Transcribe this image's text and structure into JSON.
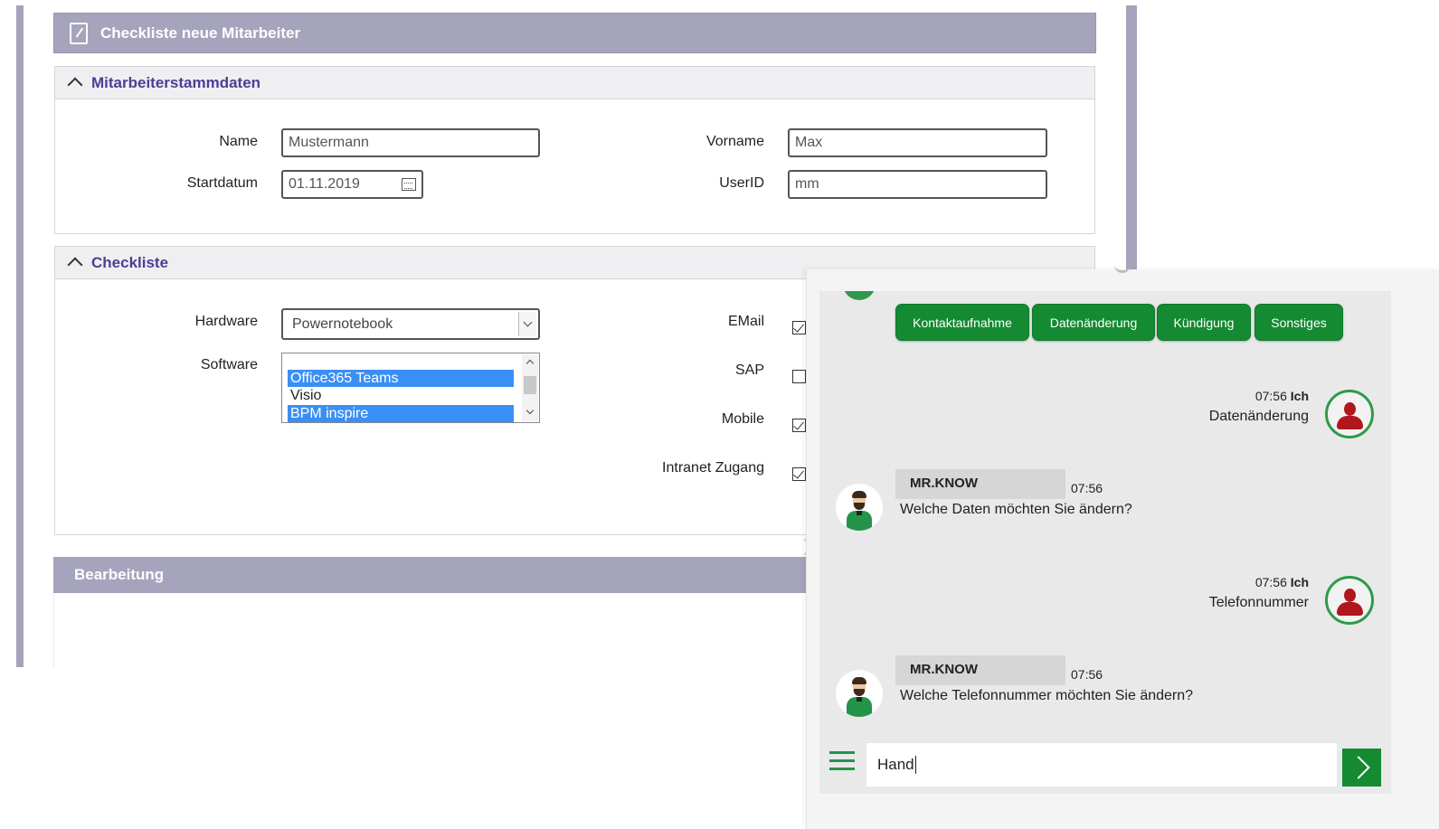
{
  "form": {
    "title": "Checkliste neue Mitarbeiter",
    "sections": {
      "stammdaten": {
        "title": "Mitarbeiterstammdaten",
        "name_label": "Name",
        "name_value": "Mustermann",
        "vorname_label": "Vorname",
        "vorname_value": "Max",
        "startdatum_label": "Startdatum",
        "startdatum_value": "01.11.2019",
        "userid_label": "UserID",
        "userid_value": "mm"
      },
      "checkliste": {
        "title": "Checkliste",
        "hardware_label": "Hardware",
        "hardware_value": "Powernotebook",
        "software_label": "Software",
        "software_options": [
          {
            "label": "Office365 Teams",
            "selected": true
          },
          {
            "label": "Visio",
            "selected": false
          },
          {
            "label": "BPM inspire",
            "selected": true
          }
        ],
        "checks": [
          {
            "label": "EMail",
            "checked": true
          },
          {
            "label": "SAP",
            "checked": false
          },
          {
            "label": "Mobile",
            "checked": true
          },
          {
            "label": "Intranet Zugang",
            "checked": true
          }
        ]
      }
    },
    "bearbeitung_title": "Bearbeitung"
  },
  "chat": {
    "quick_buttons": [
      "Kontaktaufnahme",
      "Datenänderung",
      "Kündigung",
      "Sonstiges"
    ],
    "messages": [
      {
        "from": "user",
        "time": "07:56",
        "sender": "Ich",
        "text": "Datenänderung"
      },
      {
        "from": "bot",
        "time": "07:56",
        "sender": "MR.KNOW",
        "text": "Welche Daten möchten Sie ändern?"
      },
      {
        "from": "user",
        "time": "07:56",
        "sender": "Ich",
        "text": "Telefonnummer"
      },
      {
        "from": "bot",
        "time": "07:56",
        "sender": "MR.KNOW",
        "text": "Welche Telefonnummer möchten Sie ändern?"
      }
    ],
    "input_value": "Hand",
    "accent_color": "#148a32"
  }
}
